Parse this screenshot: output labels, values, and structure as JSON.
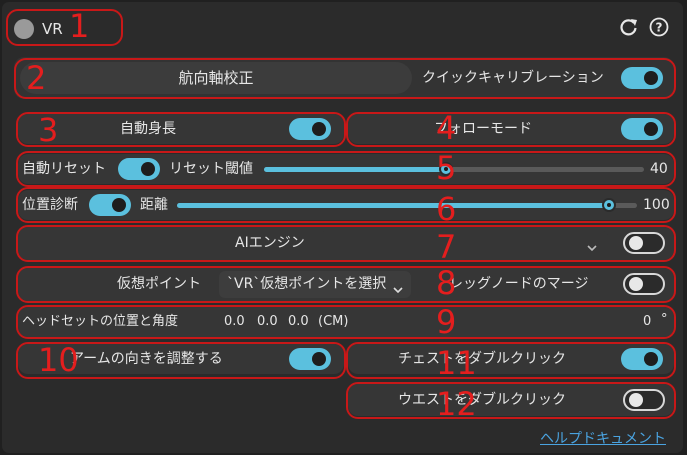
{
  "header": {
    "title": "VR"
  },
  "calibrate_button": "航向軸校正",
  "quick_calibration": {
    "label": "クイックキャリブレーション",
    "on": true
  },
  "auto_height": {
    "label": "自動身長",
    "on": true
  },
  "follow_mode": {
    "label": "フォローモード",
    "on": true
  },
  "auto_reset": {
    "label": "自動リセット",
    "on": true,
    "threshold_label": "リセット閾値",
    "threshold_value": "40",
    "threshold_fraction": 0.48
  },
  "position_diagnosis": {
    "label": "位置診断",
    "on": true,
    "distance_label": "距離",
    "distance_value": "100",
    "distance_fraction": 0.94
  },
  "ai_engine": {
    "label": "AIエンジン",
    "selected": "",
    "on": false
  },
  "virtual_point": {
    "label": "仮想ポイント",
    "selected": "`VR`仮想ポイントを選択",
    "leg_node_merge_label": "レッグノードのマージ",
    "merge_on": false
  },
  "headset": {
    "label": "ヘッドセットの位置と角度",
    "x": "0.0",
    "y": "0.0",
    "z": "0.0",
    "unit": "(CM)",
    "angle": "0",
    "degree": "°"
  },
  "adjust_arm": {
    "label": "アームの向きを調整する",
    "on": true
  },
  "chest_double_click": {
    "label": "チェストをダブルクリック",
    "on": true
  },
  "waist_double_click": {
    "label": "ウエストをダブルクリック",
    "on": false
  },
  "help_link": "ヘルプドキュメント",
  "annotations": [
    "1",
    "2",
    "3",
    "4",
    "5",
    "6",
    "7",
    "8",
    "9",
    "10",
    "11",
    "12"
  ],
  "colors": {
    "accent": "#5bc0de",
    "annotation": "#d81c1c",
    "panel": "#2b2b2b",
    "link": "#4aa3e0"
  }
}
